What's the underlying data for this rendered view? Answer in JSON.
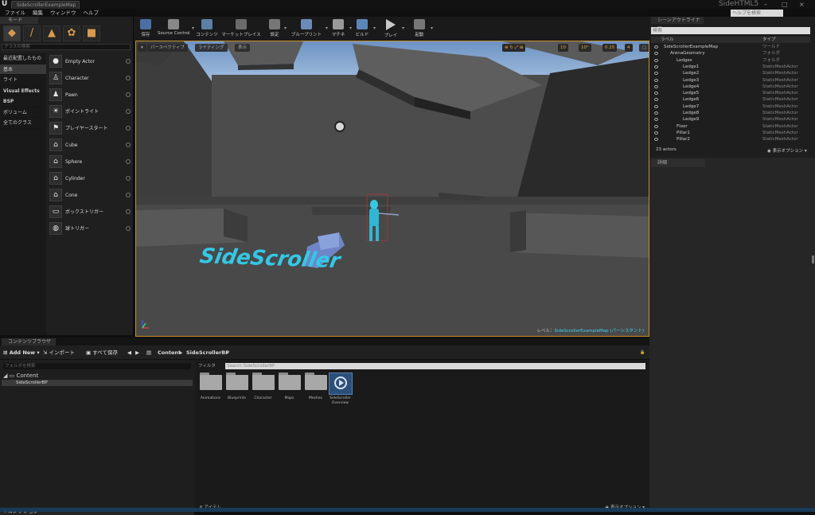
{
  "window": {
    "doc_tab": "SideScrollerExampleMap",
    "app_title": "SideHTML5",
    "help_search_placeholder": "ヘルプを検索",
    "win_min": "–",
    "win_max": "□",
    "win_close": "×"
  },
  "menu": [
    "ファイル",
    "編集",
    "ウィンドウ",
    "ヘルプ"
  ],
  "modes": {
    "tab": "モード",
    "search_placeholder": "クラスの検索",
    "categories": [
      "最近配置したもの",
      "基本",
      "ライト",
      "Visual Effects",
      "BSP",
      "ボリューム",
      "全てのクラス"
    ],
    "selected_category": "基本",
    "items": [
      "Empty Actor",
      "Character",
      "Pawn",
      "ポイントライト",
      "プレイヤースタート",
      "Cube",
      "Sphere",
      "Cylinder",
      "Cone",
      "ボックストリガー",
      "球トリガー"
    ]
  },
  "toolbar": [
    "保存",
    "Source Control",
    "コンテンツ",
    "マーケットプレイス",
    "設定",
    "ブループリント",
    "マチネ",
    "ビルド",
    "プレイ",
    "起動"
  ],
  "viewport": {
    "perspective_btn": "パースペクティブ",
    "lit_btn": "ライティング",
    "show_btn": "表示",
    "grid_snap": "10",
    "rot_snap": "10°",
    "scale_snap": "0.25",
    "cam_speed": "4",
    "floor_text": "SideScroller",
    "level_prefix": "レベル：",
    "level_name": "SideScrollerExampleMap (パーシスタント)"
  },
  "outliner": {
    "tab": "シーンアウトライナー",
    "search_placeholder": "検索",
    "col_label": "ラベル",
    "col_type": "タイプ",
    "rows": [
      {
        "name": "SideScrollerExampleMap",
        "type": "ワールド",
        "indent": 0
      },
      {
        "name": "ArenaGeometry",
        "type": "フォルダ",
        "indent": 1
      },
      {
        "name": "Ledges",
        "type": "フォルダ",
        "indent": 2
      },
      {
        "name": "Ledge1",
        "type": "StaticMeshActor",
        "indent": 3
      },
      {
        "name": "Ledge2",
        "type": "StaticMeshActor",
        "indent": 3
      },
      {
        "name": "Ledge3",
        "type": "StaticMeshActor",
        "indent": 3
      },
      {
        "name": "Ledge4",
        "type": "StaticMeshActor",
        "indent": 3
      },
      {
        "name": "Ledge5",
        "type": "StaticMeshActor",
        "indent": 3
      },
      {
        "name": "Ledge6",
        "type": "StaticMeshActor",
        "indent": 3
      },
      {
        "name": "Ledge7",
        "type": "StaticMeshActor",
        "indent": 3
      },
      {
        "name": "Ledge8",
        "type": "StaticMeshActor",
        "indent": 3
      },
      {
        "name": "Ledge9",
        "type": "StaticMeshActor",
        "indent": 3
      },
      {
        "name": "Floor",
        "type": "StaticMeshActor",
        "indent": 2
      },
      {
        "name": "Pillar1",
        "type": "StaticMeshActor",
        "indent": 2
      },
      {
        "name": "Pillar2",
        "type": "StaticMeshActor",
        "indent": 2
      }
    ],
    "count": "23 actors",
    "view_options": "表示オプション"
  },
  "details": {
    "tab": "詳細"
  },
  "content_browser": {
    "tab": "コンテンツブラウザ",
    "add_new": "Add New",
    "import": "インポート",
    "save_all": "すべて保存",
    "path_root": "Content",
    "path_leaf": "SideScrollerBP",
    "folder_search_placeholder": "フォルダを検索",
    "tree_root": "Content",
    "tree_child": "SideScrollerBP",
    "collection": "コレクション",
    "filter_label": "フィルタ",
    "search_placeholder": "Search SideScrollerBP",
    "assets": [
      "Animations",
      "Blueprints",
      "Character",
      "Maps",
      "Meshes",
      "SideScroller Overview"
    ],
    "item_count": "6 アイテム",
    "view_options": "表示オプション"
  },
  "colors": {
    "accent": "#c5912b",
    "highlight": "#3dd1f0",
    "panel": "#1f1f1f"
  }
}
